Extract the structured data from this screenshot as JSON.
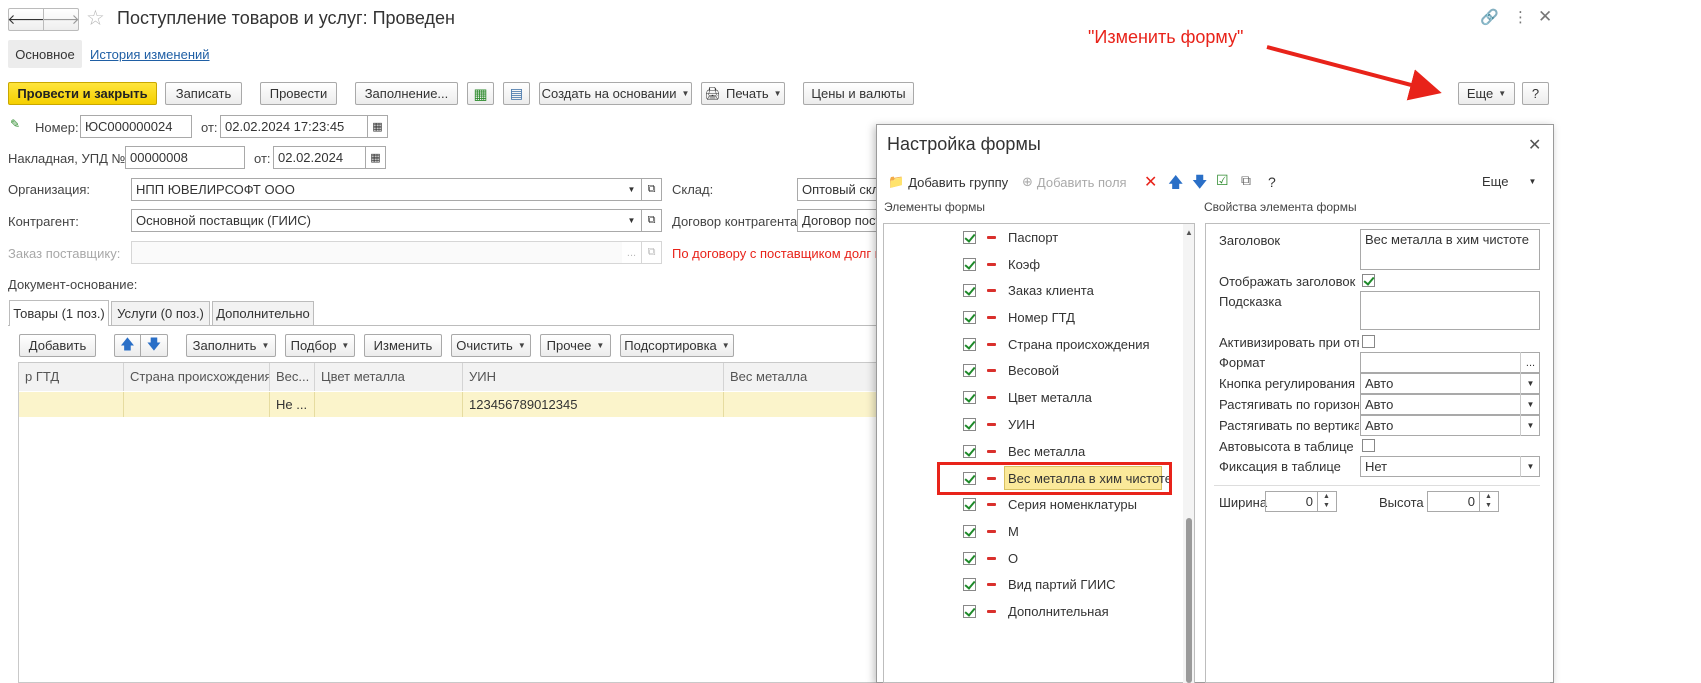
{
  "window": {
    "title": "Поступление товаров и услуг: Проведен",
    "nav_tabs": [
      "Основное",
      "История изменений"
    ]
  },
  "toolbar": {
    "post_close": "Провести и закрыть",
    "save": "Записать",
    "post": "Провести",
    "fill": "Заполнение...",
    "create_based": "Создать на основании",
    "print": "Печать",
    "prices": "Цены и валюты",
    "more": "Еще",
    "help": "?"
  },
  "annotation": {
    "text": "\"Изменить форму\"",
    "color": "#e8231a"
  },
  "header": {
    "number_label": "Номер:",
    "number_value": "ЮС000000024",
    "from_label": "от:",
    "date_value": "02.02.2024 17:23:45",
    "invoice_label": "Накладная, УПД №:",
    "invoice_value": "00000008",
    "invoice_from_label": "от:",
    "invoice_date": "02.02.2024",
    "org_label": "Организация:",
    "org_value": "НПП ЮВЕЛИРСОФТ ООО",
    "contractor_label": "Контрагент:",
    "contractor_value": "Основной поставщик (ГИИС)",
    "order_label": "Заказ поставщику:",
    "order_dots": "...",
    "warehouse_label": "Склад:",
    "warehouse_value": "Оптовый склад",
    "contract_label": "Договор  контрагента:",
    "contract_value": "Договор поставки",
    "warning": "По договору с поставщиком долг нет",
    "basis_label": "Документ-основание:"
  },
  "tabs": [
    "Товары (1 поз.)",
    "Услуги (0 поз.)",
    "Дополнительно"
  ],
  "table_toolbar": {
    "add": "Добавить",
    "fill": "Заполнить",
    "select": "Подбор",
    "change": "Изменить",
    "clear": "Очистить",
    "other": "Прочее",
    "sort": "Подсортировка"
  },
  "table": {
    "columns": [
      "р ГТД",
      "Страна происхождения",
      "Вес...",
      "Цвет металла",
      "УИН",
      "Вес металла"
    ],
    "row": [
      "",
      "",
      "Не ...",
      "",
      "123456789012345",
      ""
    ]
  },
  "dialog": {
    "title": "Настройка формы",
    "add_group": "Добавить группу",
    "add_fields": "Добавить поля",
    "help": "?",
    "more": "Еще",
    "elements_label": "Элементы формы",
    "props_label": "Свойства элемента формы",
    "tree_items": [
      "Паспорт",
      "Коэф",
      "Заказ клиента",
      "Номер ГТД",
      "Страна происхождения",
      "Весовой",
      "Цвет металла",
      "УИН",
      "Вес металла",
      "Вес металла в хим чистоте",
      "Серия номенклатуры",
      "М",
      "О",
      "Вид партий ГИИС",
      "Дополнительная"
    ],
    "props": {
      "caption_label": "Заголовок",
      "caption_value": "Вес металла в хим чистоте",
      "show_caption_label": "Отображать заголовок",
      "hint_label": "Подсказка",
      "activate_label": "Активизировать при откр",
      "format_label": "Формат",
      "format_dots": "...",
      "adjust_btn_label": "Кнопка регулирования",
      "adjust_btn_value": "Авто",
      "stretch_h_label": "Растягивать по горизонта",
      "stretch_h_value": "Авто",
      "stretch_v_label": "Растягивать по вертикали",
      "stretch_v_value": "Авто",
      "autoheight_label": "Автовысота в таблице",
      "fix_label": "Фиксация в таблице",
      "fix_value": "Нет",
      "width_label": "Ширина",
      "width_value": "0",
      "height_label": "Высота",
      "height_value": "0"
    }
  }
}
